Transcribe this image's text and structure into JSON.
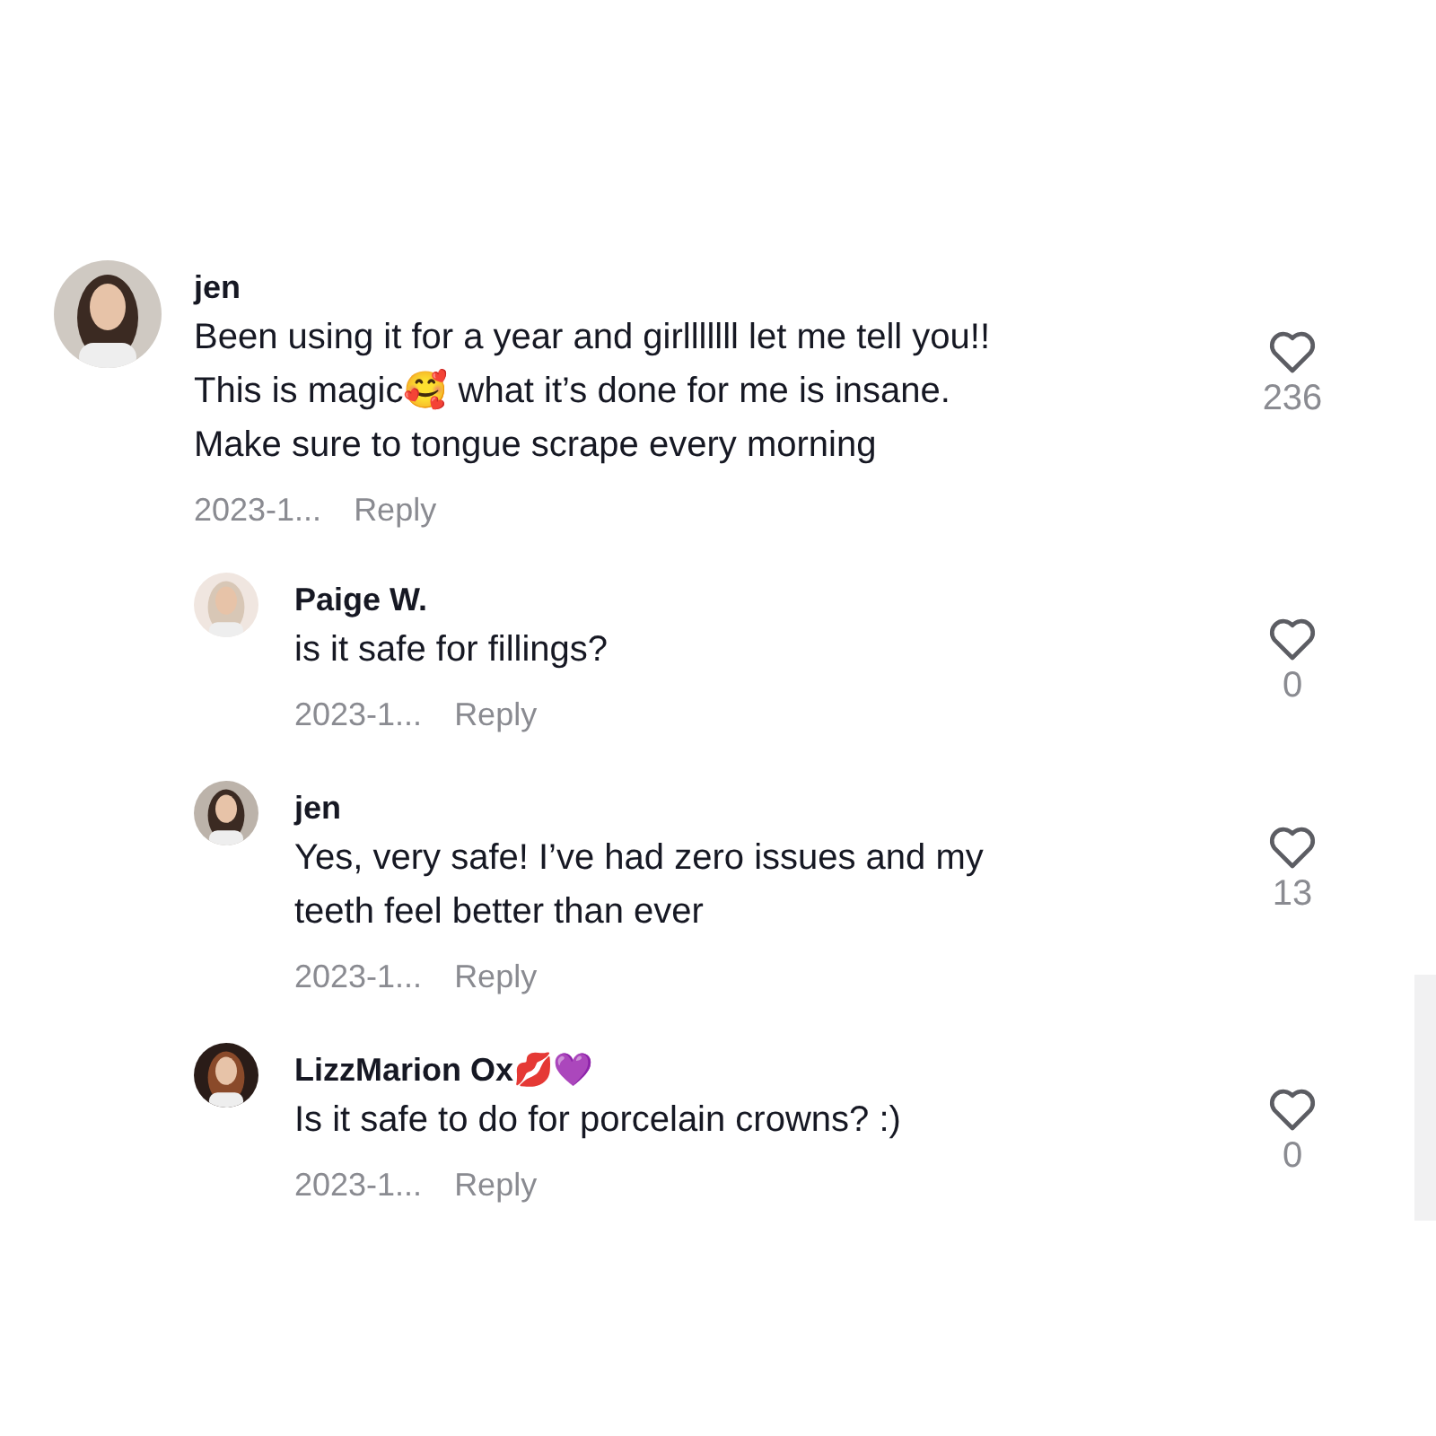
{
  "comments": [
    {
      "author": "jen",
      "text": "Been using it for a year and girlllllll let me tell you!!\nThis is magic🥰 what it’s done for me is insane.\nMake sure to tongue scrape every morning",
      "date": "2023-1...",
      "reply_label": "Reply",
      "likes": "236",
      "replies": [
        {
          "author": "Paige W.",
          "text": "is it safe for fillings?",
          "date": "2023-1...",
          "reply_label": "Reply",
          "likes": "0"
        },
        {
          "author": "jen",
          "text": "Yes, very safe! I’ve had zero issues and my\nteeth feel better than ever",
          "date": "2023-1...",
          "reply_label": "Reply",
          "likes": "13"
        },
        {
          "author": "LizzMarion Ox💋💜",
          "text": "Is it safe to do for porcelain crowns? :)",
          "date": "2023-1...",
          "reply_label": "Reply",
          "likes": "0"
        }
      ]
    }
  ]
}
